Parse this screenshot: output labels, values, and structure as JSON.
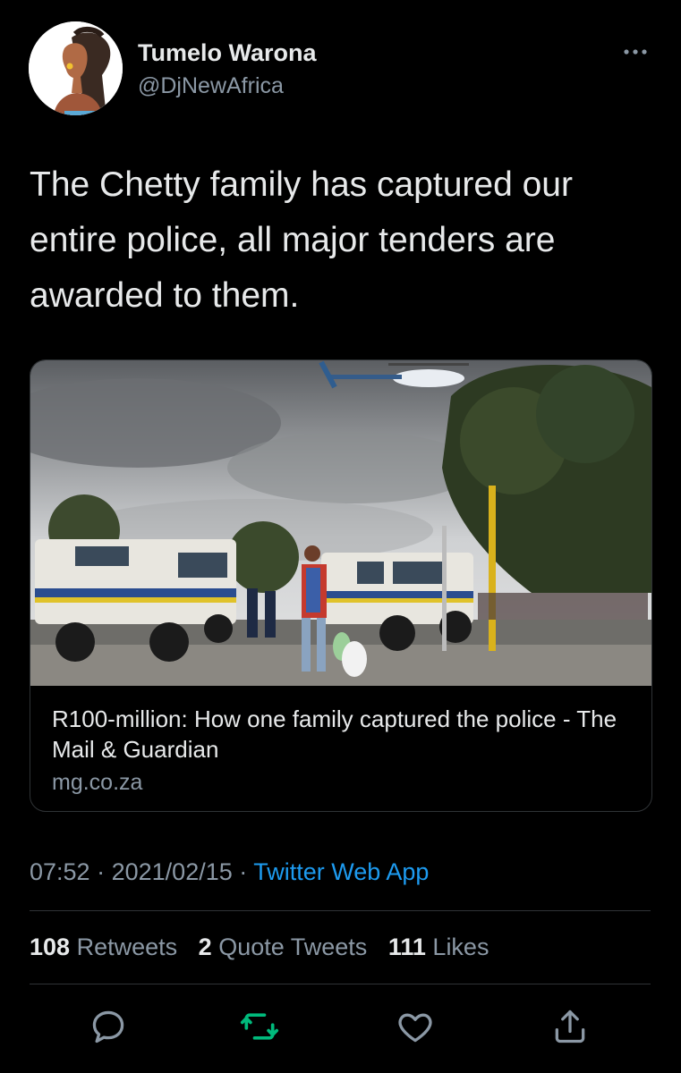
{
  "user": {
    "display_name": "Tumelo Warona",
    "handle": "@DjNewAfrica"
  },
  "tweet": {
    "text": "The Chetty family has captured our entire police, all major tenders are awarded to them."
  },
  "card": {
    "title": "R100-million: How one family captured the police - The Mail & Guardian",
    "domain": "mg.co.za",
    "image_description_icons": [
      "police-helicopter",
      "police-armored-vehicle",
      "pedestrian-carrying-bags"
    ]
  },
  "meta": {
    "time": "07:52",
    "separator": "·",
    "date": "2021/02/15",
    "source": "Twitter Web App"
  },
  "stats": {
    "retweets_count": "108",
    "retweets_label": "Retweets",
    "quotes_count": "2",
    "quotes_label": "Quote Tweets",
    "likes_count": "111",
    "likes_label": "Likes"
  },
  "actions": {
    "icons": [
      "reply-icon",
      "retweet-icon",
      "like-icon",
      "share-icon"
    ],
    "retweet_color": "#00ba7c",
    "icon_color": "#8b98a5"
  },
  "colors": {
    "background": "#000000",
    "link": "#1d9bf0",
    "muted": "#8b98a5",
    "border": "#2f3336"
  }
}
